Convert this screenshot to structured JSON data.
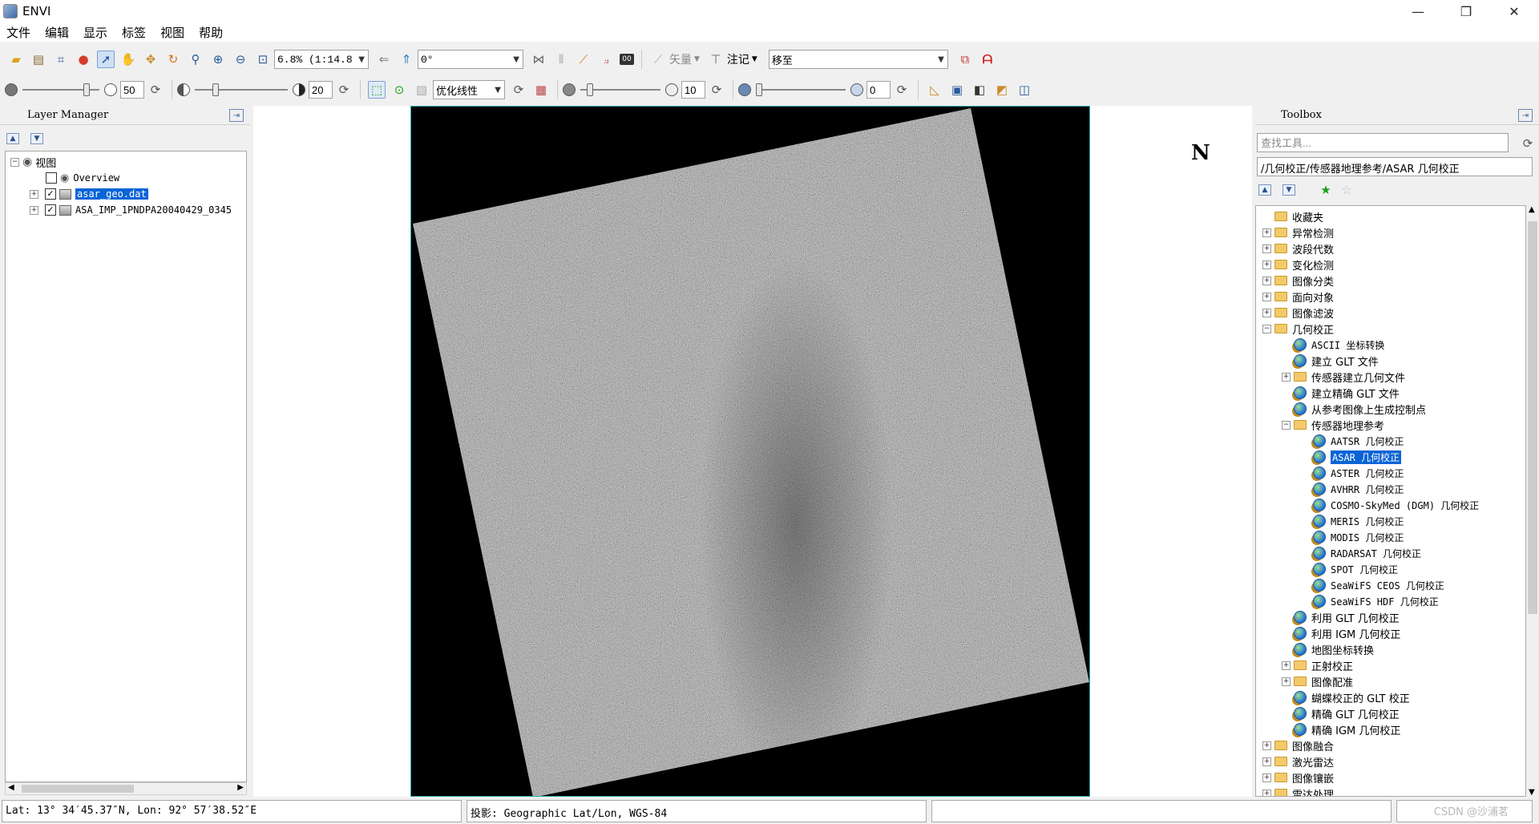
{
  "window": {
    "title": "ENVI",
    "minimize": "—",
    "maximize": "❐",
    "close": "✕"
  },
  "menu": [
    "文件",
    "编辑",
    "显示",
    "标签",
    "视图",
    "帮助"
  ],
  "toolbar1": {
    "zoom_value": "6.8% (1:14.8)",
    "rotation_value": "0°",
    "vector_label": "矢量",
    "annotation_label": "注记",
    "goto_value": "移至"
  },
  "toolbar2": {
    "brightness": "50",
    "contrast": "20",
    "stretch_value": "优化线性",
    "sharpen": "10",
    "transparency": "0"
  },
  "layer_manager": {
    "title": "Layer Manager",
    "root": "视图",
    "items": [
      {
        "label": "Overview",
        "checked": false
      },
      {
        "label": "asar_geo.dat",
        "checked": true,
        "selected": true
      },
      {
        "label": "ASA_IMP_1PNDPA20040429_0345",
        "checked": true
      }
    ]
  },
  "view": {
    "north_label": "N"
  },
  "toolbox": {
    "title": "Toolbox",
    "search_placeholder": "查找工具...",
    "path": "/几何校正/传感器地理参考/ASAR 几何校正",
    "tree": [
      {
        "label": "收藏夹",
        "type": "folder",
        "level": 0,
        "expander": ""
      },
      {
        "label": "异常检测",
        "type": "folder",
        "level": 0,
        "expander": "+"
      },
      {
        "label": "波段代数",
        "type": "folder",
        "level": 0,
        "expander": "+"
      },
      {
        "label": "变化检测",
        "type": "folder",
        "level": 0,
        "expander": "+"
      },
      {
        "label": "图像分类",
        "type": "folder",
        "level": 0,
        "expander": "+"
      },
      {
        "label": "面向对象",
        "type": "folder",
        "level": 0,
        "expander": "+"
      },
      {
        "label": "图像滤波",
        "type": "folder",
        "level": 0,
        "expander": "+"
      },
      {
        "label": "几何校正",
        "type": "folder",
        "level": 0,
        "expander": "−"
      },
      {
        "label": "ASCII 坐标转换",
        "type": "tool",
        "level": 1,
        "expander": ""
      },
      {
        "label": "建立 GLT 文件",
        "type": "tool",
        "level": 1,
        "expander": ""
      },
      {
        "label": "传感器建立几何文件",
        "type": "folder",
        "level": 1,
        "expander": "+"
      },
      {
        "label": "建立精确 GLT 文件",
        "type": "tool",
        "level": 1,
        "expander": ""
      },
      {
        "label": "从参考图像上生成控制点",
        "type": "tool",
        "level": 1,
        "expander": ""
      },
      {
        "label": "传感器地理参考",
        "type": "folder",
        "level": 1,
        "expander": "−"
      },
      {
        "label": "AATSR 几何校正",
        "type": "tool",
        "level": 2,
        "expander": ""
      },
      {
        "label": "ASAR 几何校正",
        "type": "tool",
        "level": 2,
        "expander": "",
        "selected": true
      },
      {
        "label": "ASTER 几何校正",
        "type": "tool",
        "level": 2,
        "expander": ""
      },
      {
        "label": "AVHRR 几何校正",
        "type": "tool",
        "level": 2,
        "expander": ""
      },
      {
        "label": "COSMO-SkyMed (DGM) 几何校正",
        "type": "tool",
        "level": 2,
        "expander": ""
      },
      {
        "label": "MERIS 几何校正",
        "type": "tool",
        "level": 2,
        "expander": ""
      },
      {
        "label": "MODIS 几何校正",
        "type": "tool",
        "level": 2,
        "expander": ""
      },
      {
        "label": "RADARSAT 几何校正",
        "type": "tool",
        "level": 2,
        "expander": ""
      },
      {
        "label": "SPOT 几何校正",
        "type": "tool",
        "level": 2,
        "expander": ""
      },
      {
        "label": "SeaWiFS CEOS 几何校正",
        "type": "tool",
        "level": 2,
        "expander": ""
      },
      {
        "label": "SeaWiFS HDF 几何校正",
        "type": "tool",
        "level": 2,
        "expander": ""
      },
      {
        "label": "利用 GLT 几何校正",
        "type": "tool",
        "level": 1,
        "expander": ""
      },
      {
        "label": "利用 IGM 几何校正",
        "type": "tool",
        "level": 1,
        "expander": ""
      },
      {
        "label": "地图坐标转换",
        "type": "tool",
        "level": 1,
        "expander": ""
      },
      {
        "label": "正射校正",
        "type": "folder",
        "level": 1,
        "expander": "+"
      },
      {
        "label": "图像配准",
        "type": "folder",
        "level": 1,
        "expander": "+"
      },
      {
        "label": "蝴蝶校正的 GLT 校正",
        "type": "tool",
        "level": 1,
        "expander": ""
      },
      {
        "label": "精确 GLT 几何校正",
        "type": "tool",
        "level": 1,
        "expander": ""
      },
      {
        "label": "精确 IGM 几何校正",
        "type": "tool",
        "level": 1,
        "expander": ""
      },
      {
        "label": "图像融合",
        "type": "folder",
        "level": 0,
        "expander": "+"
      },
      {
        "label": "激光雷达",
        "type": "folder",
        "level": 0,
        "expander": "+"
      },
      {
        "label": "图像镶嵌",
        "type": "folder",
        "level": 0,
        "expander": "+"
      },
      {
        "label": "雷达处理",
        "type": "folder",
        "level": 0,
        "expander": "+"
      }
    ]
  },
  "status": {
    "coords": "Lat: 13° 34′45.37″N, Lon: 92° 57′38.52″E",
    "projection": "投影: Geographic Lat/Lon, WGS-84",
    "empty": "",
    "watermark": "CSDN @沙浦茗"
  }
}
